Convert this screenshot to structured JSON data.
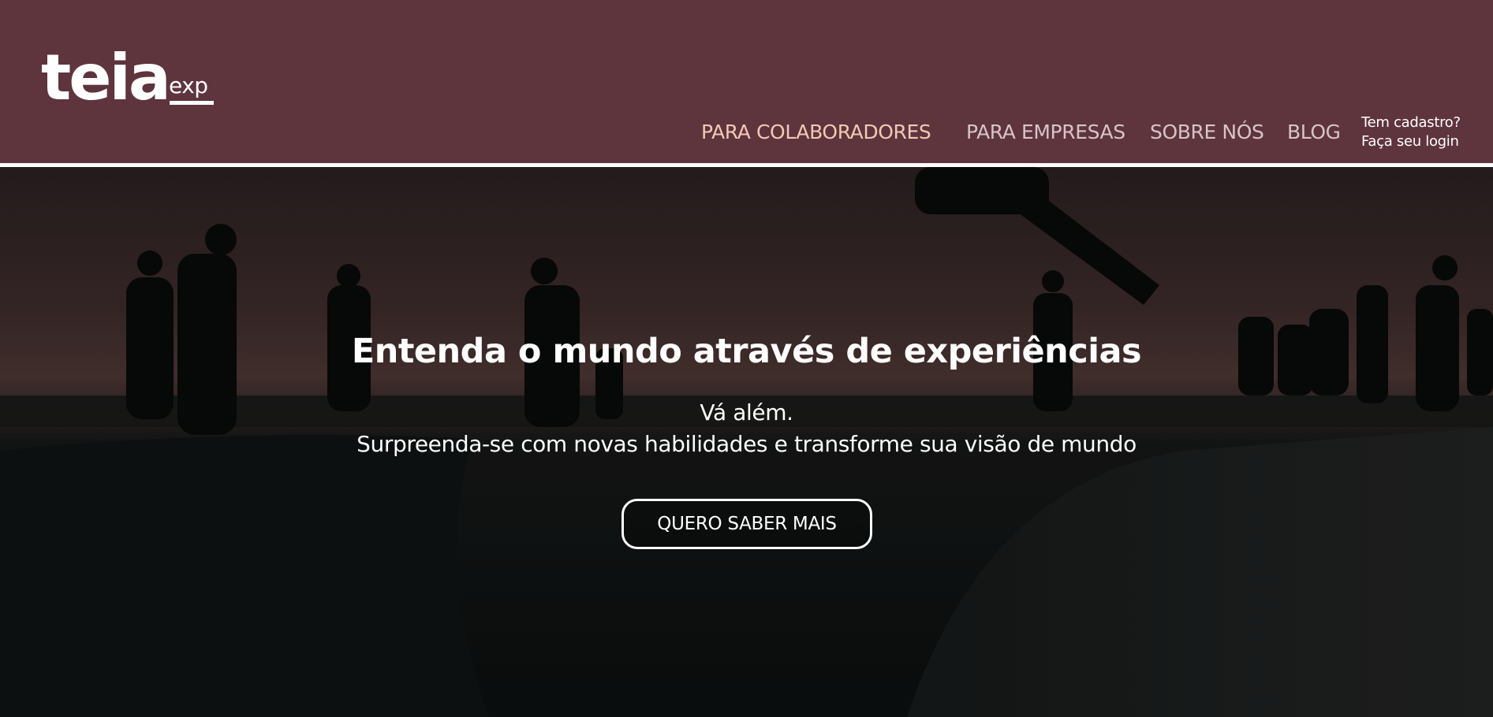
{
  "brand": {
    "logo_main": "teia",
    "logo_sub": "exp"
  },
  "nav": {
    "items": [
      {
        "label": "PARA COLABORADORES",
        "active": true
      },
      {
        "label": "PARA EMPRESAS"
      },
      {
        "label": "SOBRE NÓS"
      },
      {
        "label": "BLOG"
      }
    ],
    "login_line1": "Tem cadastro?",
    "login_line2": "Faça seu login"
  },
  "hero": {
    "title": "Entenda o mundo através de experiências",
    "subtitle_line1": "Vá além.",
    "subtitle_line2": "Surpreenda-se com novas habilidades e transforme sua visão de mundo",
    "cta_label": "QUERO SABER MAIS"
  },
  "colors": {
    "header_bg": "#5e343d",
    "nav_active": "#f3c9b5",
    "nav_default": "#d8c4c8",
    "text": "#ffffff"
  }
}
